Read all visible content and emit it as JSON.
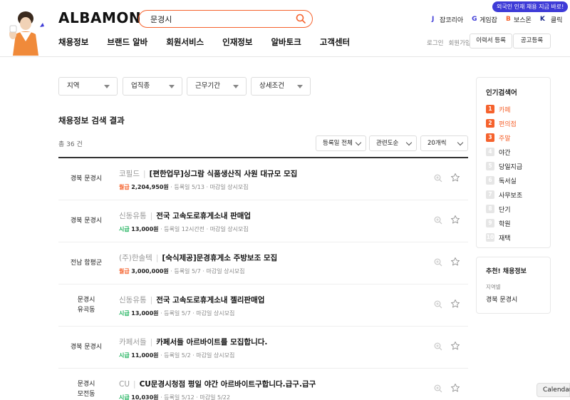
{
  "header": {
    "logo": "ALBAMON",
    "search_value": "문경시",
    "promo_badge": "외국인 인재 채용 지금 바로!",
    "partners": [
      {
        "label": "잡코리아",
        "icon": "J",
        "color": "#3e3bd7"
      },
      {
        "label": "게임잡",
        "icon": "G",
        "color": "#3e3bd7"
      },
      {
        "label": "보스몬",
        "icon": "B",
        "color": "#f5622d"
      },
      {
        "label": "클릭",
        "icon": "K",
        "color": "#1b2a8a"
      }
    ],
    "nav": [
      "채용정보",
      "브랜드 알바",
      "회원서비스",
      "인재정보",
      "알바토크",
      "고객센터"
    ],
    "login": "로그인",
    "signup": "회원가입",
    "resume_button": "이력서 등록",
    "post_button": "공고등록"
  },
  "filters": [
    "지역",
    "업직종",
    "근무기간",
    "상세조건"
  ],
  "results": {
    "title": "채용정보 검색 결과",
    "total": "총 36 건",
    "sort_options": [
      "등록일 전체",
      "관련도순",
      "20개씩"
    ]
  },
  "jobs": [
    {
      "loc1": "경북 문경시",
      "loc2": "",
      "company": "코필드",
      "job": "[편한업무]싱그람 식품생산직 사원 대규모 모집",
      "wage_type": "월급",
      "wage_class": "wt-monthly",
      "wage": "2,204,950원",
      "date": "등록일 5/13",
      "deadline": "마감일 상시모집"
    },
    {
      "loc1": "경북 문경시",
      "loc2": "",
      "company": "신동유통",
      "job": "전국 고속도로휴게소내 판매업",
      "wage_type": "시급",
      "wage_class": "wt-hourly",
      "wage": "13,000원",
      "date": "등록일 12시간전",
      "deadline": "마감일 상시모집"
    },
    {
      "loc1": "전남 함평군",
      "loc2": "",
      "company": "(주)한솔텍",
      "job": "[숙식제공]문경휴게소 주방보조 모집",
      "wage_type": "월급",
      "wage_class": "wt-monthly",
      "wage": "3,000,000원",
      "date": "등록일 5/7",
      "deadline": "마감일 상시모집"
    },
    {
      "loc1": "문경시",
      "loc2": "유곡동",
      "company": "신동유통",
      "job": "전국 고속도로휴게소내 젤리판매업",
      "wage_type": "시급",
      "wage_class": "wt-hourly",
      "wage": "13,000원",
      "date": "등록일 5/7",
      "deadline": "마감일 상시모집"
    },
    {
      "loc1": "경북 문경시",
      "loc2": "",
      "company": "카페서들",
      "job": "카페서들 아르바이트를 모집합니다.",
      "wage_type": "시급",
      "wage_class": "wt-hourly",
      "wage": "11,000원",
      "date": "등록일 5/2",
      "deadline": "마감일 상시모집"
    },
    {
      "loc1": "문경시",
      "loc2": "모전동",
      "company": "CU",
      "job": "CU문경시청점 평일 야간 아르바이트구합니다.급구.급구",
      "wage_type": "시급",
      "wage_class": "wt-hourly",
      "wage": "10,030원",
      "date": "등록일 5/12",
      "deadline": "마감일 5/22"
    }
  ],
  "popular": {
    "title": "인기검색어",
    "items": [
      {
        "rank": "1",
        "keyword": "카페",
        "hot": true
      },
      {
        "rank": "2",
        "keyword": "편의점",
        "hot": true
      },
      {
        "rank": "3",
        "keyword": "주말",
        "hot": true
      },
      {
        "rank": "4",
        "keyword": "야간",
        "hot": false
      },
      {
        "rank": "5",
        "keyword": "당일지급",
        "hot": false
      },
      {
        "rank": "6",
        "keyword": "독서실",
        "hot": false
      },
      {
        "rank": "7",
        "keyword": "사무보조",
        "hot": false
      },
      {
        "rank": "8",
        "keyword": "단기",
        "hot": false
      },
      {
        "rank": "9",
        "keyword": "학원",
        "hot": false
      },
      {
        "rank": "10",
        "keyword": "재택",
        "hot": false
      }
    ]
  },
  "recommend": {
    "title": "추천! 채용정보",
    "sub": "지역별",
    "value": "경북 문경시"
  },
  "calendar_label": "Calendar",
  "colors": {
    "accent": "#f5622d",
    "hourly": "#1bb15a",
    "promo": "#3e3bd7"
  }
}
